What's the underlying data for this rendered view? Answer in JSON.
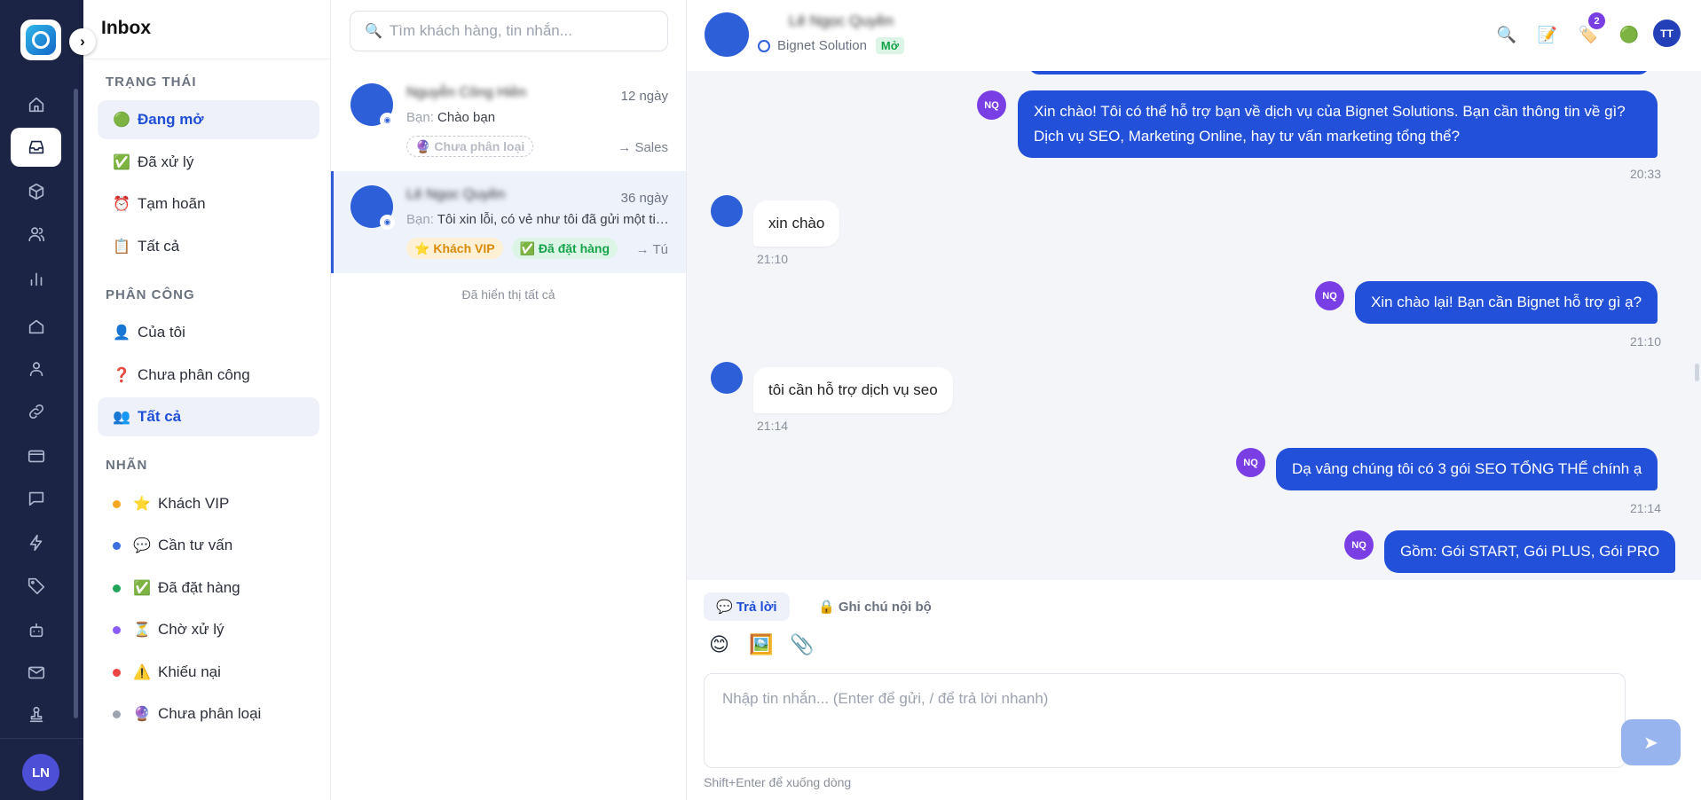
{
  "rail": {
    "avatar": "LN"
  },
  "sidebar": {
    "title": "Inbox",
    "status_heading": "TRẠNG THÁI",
    "status_items": [
      {
        "icon": "🟢",
        "label": "Đang mở"
      },
      {
        "icon": "✅",
        "label": "Đã xử lý"
      },
      {
        "icon": "⏰",
        "label": "Tạm hoãn"
      },
      {
        "icon": "📋",
        "label": "Tất cả"
      }
    ],
    "assign_heading": "PHÂN CÔNG",
    "assign_items": [
      {
        "icon": "👤",
        "label": "Của tôi"
      },
      {
        "icon": "❓",
        "label": "Chưa phân công"
      },
      {
        "icon": "👥",
        "label": "Tất cả"
      }
    ],
    "labels_heading": "NHÃN",
    "labels": [
      {
        "color": "#f5a623",
        "icon": "⭐",
        "label": "Khách VIP"
      },
      {
        "color": "#3b6fe0",
        "icon": "💬",
        "label": "Cần tư vấn"
      },
      {
        "color": "#22a55a",
        "icon": "✅",
        "label": "Đã đặt hàng"
      },
      {
        "color": "#8b5cf6",
        "icon": "⏳",
        "label": "Chờ xử lý"
      },
      {
        "color": "#ef4444",
        "icon": "⚠️",
        "label": "Khiếu nại"
      },
      {
        "color": "#9ca3af",
        "icon": "🔮",
        "label": "Chưa phân loại"
      }
    ]
  },
  "list": {
    "search_placeholder": "Tìm khách hàng, tin nhắn...",
    "conversations": [
      {
        "name": "Nguyễn Công Hiền",
        "time": "12 ngày",
        "prefix": "Bạn:",
        "preview": "Chào bạn",
        "tags": [
          "Chưa phân loại"
        ],
        "assignee": "→ Sales"
      },
      {
        "name": "Lê Ngọc Quyền",
        "time": "36 ngày",
        "prefix": "Bạn:",
        "preview": "Tôi xin lỗi, có vẻ như tôi đã gửi một tin nhắn",
        "tags": [
          "Khách VIP",
          "Đã đặt hàng"
        ],
        "assignee": "→ Tú"
      }
    ],
    "all_shown": "Đã hiển thị tất cả"
  },
  "header": {
    "name": "Lê Ngọc Quyền",
    "page": "Bignet Solution",
    "status": "Mở",
    "badge_count": "2",
    "me": "TT"
  },
  "messages": {
    "m1": {
      "text": "Xin chào! Tôi có thể hỗ trợ bạn về dịch vụ của Bignet Solutions. Bạn cần thông tin về gì? Dịch vụ SEO, Marketing Online, hay tư vấn marketing tổng thể?",
      "time": "20:33",
      "agent": "NQ"
    },
    "m2": {
      "text": "xin chào",
      "time": "21:10"
    },
    "m3": {
      "text": "Xin chào lại! Bạn cần Bignet hỗ trợ gì ạ?",
      "time": "21:10",
      "agent": "NQ"
    },
    "m4": {
      "text": "tôi cần hỗ trợ dịch vụ seo",
      "time": "21:14"
    },
    "m5": {
      "text": "Dạ vâng chúng tôi có 3 gói SEO TỔNG THỂ chính ạ",
      "time": "21:14",
      "agent": "NQ"
    },
    "m6": {
      "text": "Gồm: Gói START, Gói PLUS, Gói PRO",
      "agent": "NQ"
    }
  },
  "composer": {
    "tab_reply": "💬 Trả lời",
    "tab_note": "🔒 Ghi chú nội bộ",
    "tools": [
      "😊",
      "🖼️",
      "📎"
    ],
    "placeholder": "Nhập tin nhắn... (Enter để gửi, / để trả lời nhanh)",
    "hint": "Shift+Enter để xuống dòng"
  }
}
